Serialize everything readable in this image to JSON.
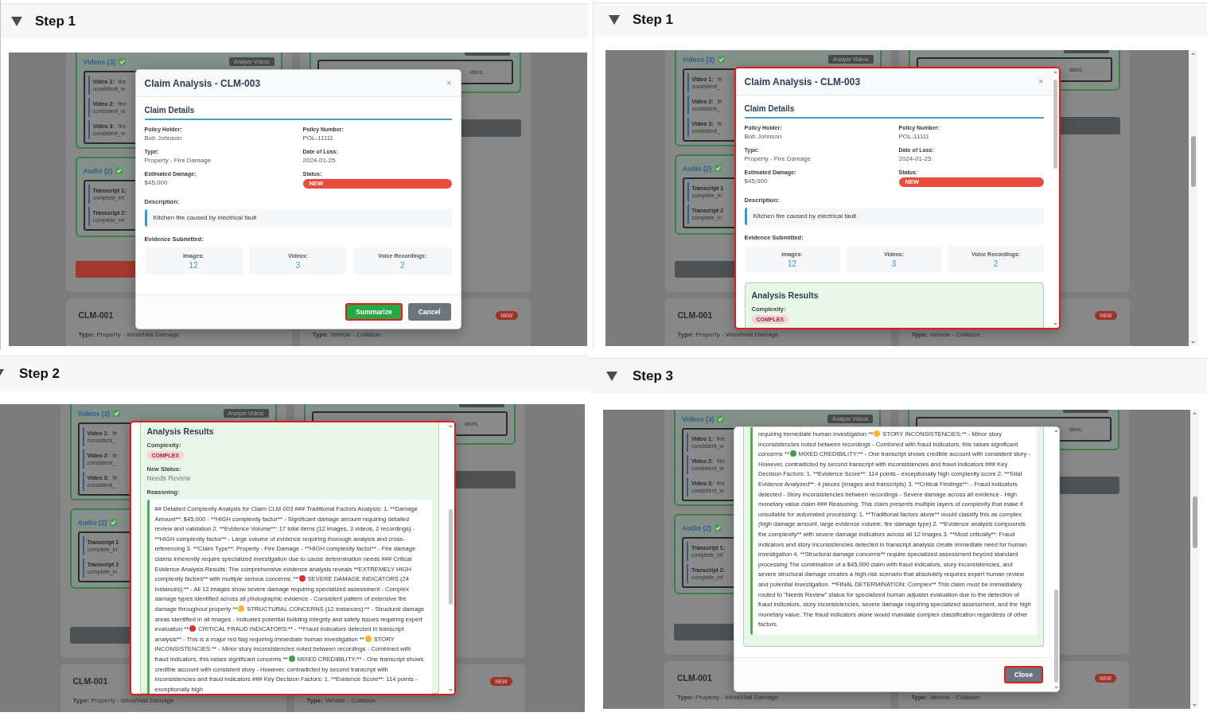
{
  "panels": [
    {
      "header": {
        "title": "Step 1",
        "expanded": true
      },
      "app": {
        "page_scrollbar": false,
        "videos": {
          "title": "Videos (3)",
          "checked": true,
          "button": "Analyze Videos",
          "items": [
            {
              "label": "Video 1:",
              "text": "fire",
              "detail": "consistent_w"
            },
            {
              "label": "Video 2:",
              "text": "fire",
              "detail": "consistent_w"
            },
            {
              "label": "Video 3:",
              "text": "fire",
              "detail": "consistent_w"
            }
          ]
        },
        "audio": {
          "title": "Audio (2)",
          "checked": true,
          "items": [
            {
              "label": "Transcript 1:",
              "detail": "complete_inf"
            },
            {
              "label": "Transcript 2:",
              "detail": "complete_inf"
            }
          ]
        },
        "action_bar": {
          "disabled": false
        },
        "side_card": {
          "snippet": "ators,"
        },
        "claims": {
          "left": {
            "id": "CLM-001",
            "type": "**Type:** Property - Wind/Hail Damage"
          },
          "right": {
            "badge": "NEW",
            "type": "**Type:** Vehicle - Collision"
          }
        }
      },
      "modal": {
        "highlighted": false,
        "scrollable": false,
        "header": {
          "title": "Claim Analysis - CLM-003",
          "close": "×"
        },
        "details": {
          "heading": "Claim Details",
          "fields": [
            {
              "kind": "text",
              "label": "Policy Holder:",
              "value": "Bob Johnson"
            },
            {
              "kind": "text",
              "label": "Policy Number:",
              "value": "POL-11111"
            },
            {
              "kind": "text",
              "label": "Type:",
              "value": "Property - Fire Damage"
            },
            {
              "kind": "text",
              "label": "Date of Loss:",
              "value": "2024-01-25"
            },
            {
              "kind": "text",
              "label": "Estimated Damage:",
              "value": "$45,000"
            },
            {
              "kind": "badge",
              "label": "Status:",
              "value": "NEW"
            }
          ],
          "description": {
            "label": "Description:",
            "text": "Kitchen fire caused by electrical fault"
          },
          "evidence": {
            "label": "Evidence Submitted:",
            "items": [
              {
                "label": "Images:",
                "count": "12"
              },
              {
                "label": "Videos:",
                "count": "3"
              },
              {
                "label": "Voice Recordings:",
                "count": "2"
              }
            ]
          }
        },
        "footer": {
          "buttons": [
            {
              "kind": "primary",
              "label": "Summarize",
              "highlighted": true
            },
            {
              "kind": "secondary",
              "label": "Cancel",
              "highlighted": false
            }
          ]
        }
      }
    },
    {
      "header": {
        "title": "Step 1",
        "expanded": true
      },
      "app": {
        "page_scrollbar": true,
        "videos": {
          "title": "Videos (3)",
          "checked": true,
          "button": "Analyze Videos",
          "items": [
            {
              "label": "Video 1:",
              "text": "fir",
              "detail": "consistent_"
            },
            {
              "label": "Video 2:",
              "text": "fir",
              "detail": "consistent_"
            },
            {
              "label": "Video 3:",
              "text": "fir",
              "detail": "consistent_"
            }
          ]
        },
        "audio": {
          "title": "Audio (2)",
          "checked": true,
          "items": [
            {
              "label": "Transcript 1",
              "detail": "complete_in"
            },
            {
              "label": "Transcript 2",
              "detail": "complete_in"
            }
          ]
        },
        "action_bar": {
          "disabled": true
        },
        "side_card": {
          "snippet": "ators,"
        },
        "claims": {
          "left": {
            "id": "CLM-001",
            "type": "**Type:** Property - Wind/Hail Damage"
          },
          "right": {
            "badge": "NEW",
            "type": "**Type:** Vehicle - Collision"
          }
        }
      },
      "modal": {
        "highlighted": true,
        "scrollable": true,
        "header": {
          "title": "Claim Analysis - CLM-003",
          "close": "×"
        },
        "details": {
          "heading": "Claim Details",
          "fields": [
            {
              "kind": "text",
              "label": "Policy Holder:",
              "value": "Bob Johnson"
            },
            {
              "kind": "text",
              "label": "Policy Number:",
              "value": "POL-11111"
            },
            {
              "kind": "text",
              "label": "Type:",
              "value": "Property - Fire Damage"
            },
            {
              "kind": "text",
              "label": "Date of Loss:",
              "value": "2024-01-25"
            },
            {
              "kind": "text",
              "label": "Estimated Damage:",
              "value": "$45,000"
            },
            {
              "kind": "badge",
              "label": "Status:",
              "value": "NEW"
            }
          ],
          "description": {
            "label": "Description:",
            "text": "Kitchen fire caused by electrical fault"
          },
          "evidence": {
            "label": "Evidence Submitted:",
            "items": [
              {
                "label": "Images:",
                "count": "12"
              },
              {
                "label": "Videos:",
                "count": "3"
              },
              {
                "label": "Voice Recordings:",
                "count": "2"
              }
            ]
          }
        },
        "analysis": {
          "heading": "Analysis Results",
          "complexity": {
            "label": "Complexity:",
            "badge": "COMPLEX"
          }
        }
      }
    },
    {
      "header": {
        "title": "Step 2",
        "expanded": true
      },
      "app": {
        "page_scrollbar": false,
        "videos": {
          "title": "Videos (3)",
          "checked": true,
          "button": "Analyze Videos",
          "items": [
            {
              "label": "Video 1:",
              "text": "fir",
              "detail": "consistent_"
            },
            {
              "label": "Video 2:",
              "text": "fir",
              "detail": "consistent_"
            },
            {
              "label": "Video 3:",
              "text": "fir",
              "detail": "consistent_"
            }
          ]
        },
        "audio": {
          "title": "Audio (2)",
          "checked": true,
          "items": [
            {
              "label": "Transcript 1",
              "detail": "complete_in"
            },
            {
              "label": "Transcript 2",
              "detail": "complete_in"
            }
          ]
        },
        "action_bar": {
          "disabled": true
        },
        "side_card": {
          "snippet": "ators,"
        },
        "claims": {
          "left": {
            "id": "CLM-001",
            "type": "**Type:** Property - Wind/Hail Damage"
          },
          "right": {
            "badge": "NEW",
            "type": "**Type:** Vehicle - Collision"
          }
        }
      },
      "modal": {
        "highlighted": true,
        "scrollable": true,
        "analysis": {
          "heading": "Analysis Results",
          "complexity": {
            "label": "Complexity:",
            "badge": "COMPLEX"
          },
          "new_status": {
            "label": "New Status:",
            "value": "Needs Review"
          },
          "reasoning": {
            "label": "Reasoning:",
            "segments": [
              {
                "kind": "text",
                "text": "## Detailed Complexity Analysis for Claim CLM-003 ### Traditional Factors Analysis: 1. **Damage Amount**: $45,000 - **HIGH complexity factor** - Significant damage amount requiring detailed review and validation 2. **Evidence Volume**: 17 total items (12 images, 3 videos, 2 recordings) - **HIGH complexity factor** - Large volume of evidence requiring thorough analysis and cross-referencing 3. **Claim Type**: Property - Fire Damage - **HIGH complexity factor** - Fire damage claims inherently require specialized investigation due to cause determination needs ### Critical Evidence Analysis Results: The comprehensive evidence analysis reveals **EXTREMELY HIGH complexity factors** with multiple serious concerns: **"
              },
              {
                "kind": "dot",
                "color": "#e0312c"
              },
              {
                "kind": "text",
                "text": "SEVERE DAMAGE INDICATORS (24 instances):** - All 12 images show severe damage requiring specialized assessment - Complex damage types identified across all photographic evidence - Consistent pattern of extensive fire damage throughout property **"
              },
              {
                "kind": "dot",
                "color": "#f6b928"
              },
              {
                "kind": "text",
                "text": "STRUCTURAL CONCERNS (12 instances):** - Structural damage areas identified in all images - Indicates potential building integrity and safety issues requiring expert evaluation **"
              },
              {
                "kind": "dot",
                "color": "#e0312c"
              },
              {
                "kind": "text",
                "text": "CRITICAL FRAUD INDICATORS:** - **Fraud indicators detected in transcript analysis** - This is a major red flag requiring immediate human investigation **"
              },
              {
                "kind": "dot",
                "color": "#f6b928"
              },
              {
                "kind": "text",
                "text": "STORY INCONSISTENCIES:** - Minor story inconsistencies noted between recordings - Combined with fraud indicators, this raises significant concerns **"
              },
              {
                "kind": "dot",
                "color": "#43a047"
              },
              {
                "kind": "text",
                "text": "MIXED CREDIBILITY:** - One transcript shows credible account with consistent story - However, contradicted by second transcript with inconsistencies and fraud indicators ### Key Decision Factors: 1. **Evidence Score**: 114 points - exceptionally high"
              }
            ]
          }
        }
      }
    },
    {
      "header": {
        "title": "Step 3",
        "expanded": true
      },
      "app": {
        "page_scrollbar": true,
        "videos": {
          "title": "Videos (3)",
          "checked": true,
          "button": "Analyze Videos",
          "items": [
            {
              "label": "Video 1:",
              "text": "fire",
              "detail": "consistent_w"
            },
            {
              "label": "Video 2:",
              "text": "fire",
              "detail": "consistent_w"
            },
            {
              "label": "Video 3:",
              "text": "fire",
              "detail": "consistent_w"
            }
          ]
        },
        "audio": {
          "title": "Audio (2)",
          "checked": true,
          "items": [
            {
              "label": "Transcript 1:",
              "detail": "complete_inf"
            },
            {
              "label": "Transcript 2:",
              "detail": "complete_inf"
            }
          ]
        },
        "action_bar": {
          "disabled": true
        },
        "side_card": {
          "snippet": "ators,"
        },
        "claims": {
          "left": {
            "id": "CLM-001",
            "type": "**Type:** Property - Wind/Hail Damage"
          },
          "right": {
            "badge": "NEW",
            "type": "**Type:** Vehicle - Collision"
          }
        }
      },
      "modal": {
        "highlighted": false,
        "scrollable": true,
        "analysis": {
          "reasoning": {
            "segments": [
              {
                "kind": "text",
                "text": "requiring immediate human investigation **"
              },
              {
                "kind": "dot",
                "color": "#f6b928"
              },
              {
                "kind": "text",
                "text": "STORY INCONSISTENCIES:** - Minor story inconsistencies noted between recordings - Combined with fraud indicators, this raises significant concerns **"
              },
              {
                "kind": "dot",
                "color": "#43a047"
              },
              {
                "kind": "text",
                "text": "MIXED CREDIBILITY:** - One transcript shows credible account with consistent story - However, contradicted by second transcript with inconsistencies and fraud indicators ### Key Decision Factors: 1. **Evidence Score**: 114 points - exceptionally high complexity score 2. **Total Evidence Analyzed**: 4 pieces (images and transcripts) 3. **Critical Findings**: - Fraud indicators detected - Story inconsistencies between recordings - Severe damage across all evidence - High monetary value claim ### Reasoning: This claim presents multiple layers of complexity that make it unsuitable for automated processing: 1. **Traditional factors alone** would classify this as complex (high damage amount, large evidence volume, fire damage type) 2. **Evidence analysis compounds the complexity** with severe damage indicators across all 12 images 3. **Most critically**: Fraud indicators and story inconsistencies detected in transcript analysis create immediate need for human investigation 4. **Structural damage concerns** require specialized assessment beyond standard processing The combination of a $45,000 claim with fraud indicators, story inconsistencies, and severe structural damage creates a high-risk scenario that absolutely requires expert human review and potential investigation. **FINAL DETERMINATION: Complex** This claim must be immediately routed to \"Needs Review\" status for specialized human adjuster evaluation due to the detection of fraud indicators, story inconsistencies, severe damage requiring specialized assessment, and the high monetary value. The fraud indicators alone would mandate complex classification regardless of other factors."
              }
            ]
          }
        },
        "footer": {
          "buttons": [
            {
              "kind": "secondary",
              "label": "Close",
              "highlighted": true
            }
          ]
        }
      }
    }
  ]
}
